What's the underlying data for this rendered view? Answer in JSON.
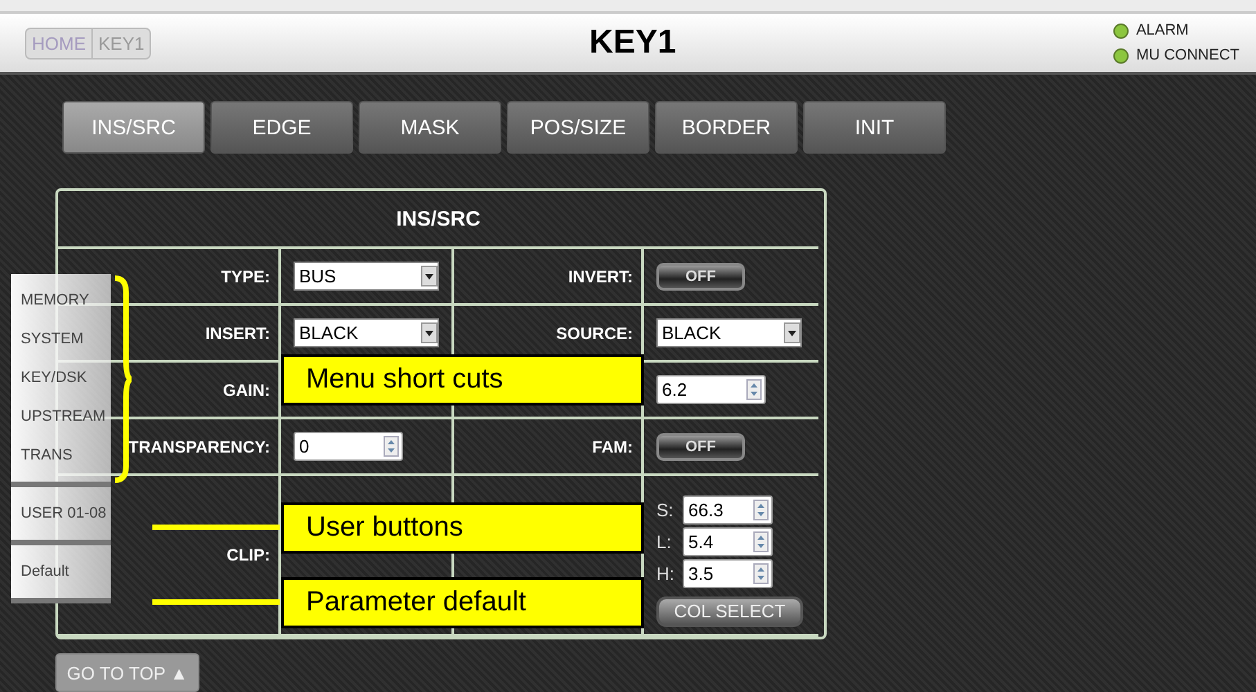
{
  "header": {
    "breadcrumbs": [
      "HOME",
      "KEY1"
    ],
    "title": "KEY1",
    "indicators": [
      {
        "label": "ALARM",
        "on": true
      },
      {
        "label": "MU CONNECT",
        "on": true
      }
    ]
  },
  "tabs": [
    {
      "label": "INS/SRC",
      "selected": true
    },
    {
      "label": "EDGE",
      "selected": false
    },
    {
      "label": "MASK",
      "selected": false
    },
    {
      "label": "POS/SIZE",
      "selected": false
    },
    {
      "label": "BORDER",
      "selected": false
    },
    {
      "label": "INIT",
      "selected": false
    }
  ],
  "panel": {
    "title": "INS/SRC",
    "rows": [
      {
        "left": {
          "label": "TYPE:",
          "control": {
            "kind": "select",
            "value": "BUS"
          }
        },
        "right": {
          "label": "INVERT:",
          "control": {
            "kind": "toggle",
            "value": "OFF",
            "on": false
          }
        }
      },
      {
        "left": {
          "label": "INSERT:",
          "control": {
            "kind": "select",
            "value": "BLACK"
          }
        },
        "right": {
          "label": "SOURCE:",
          "control": {
            "kind": "select",
            "value": "BLACK"
          }
        }
      },
      {
        "left": {
          "label": "GAIN:"
        },
        "right": {
          "control": {
            "kind": "spin",
            "value": "6.2"
          }
        }
      },
      {
        "left": {
          "label": "TRANSPARENCY:",
          "control": {
            "kind": "spin",
            "value": "0"
          }
        },
        "right": {
          "label": "FAM:",
          "control": {
            "kind": "toggle",
            "value": "OFF",
            "on": false
          }
        }
      },
      {
        "left": {
          "label": "CLIP:"
        },
        "right": {
          "control": {
            "kind": "color",
            "fields": [
              {
                "label": "S:",
                "value": "66.3"
              },
              {
                "label": "L:",
                "value": "5.4"
              },
              {
                "label": "H:",
                "value": "3.5"
              }
            ],
            "button": "COL SELECT"
          }
        }
      }
    ]
  },
  "menu": {
    "shortcuts": [
      "MEMORY",
      "SYSTEM",
      "KEY/DSK",
      "UPSTREAM",
      "TRANS"
    ],
    "user": "USER 01-08",
    "default": "Default"
  },
  "go_to_top": "GO TO TOP ▲",
  "callouts": [
    "Menu short cuts",
    "User buttons",
    "Parameter default"
  ]
}
